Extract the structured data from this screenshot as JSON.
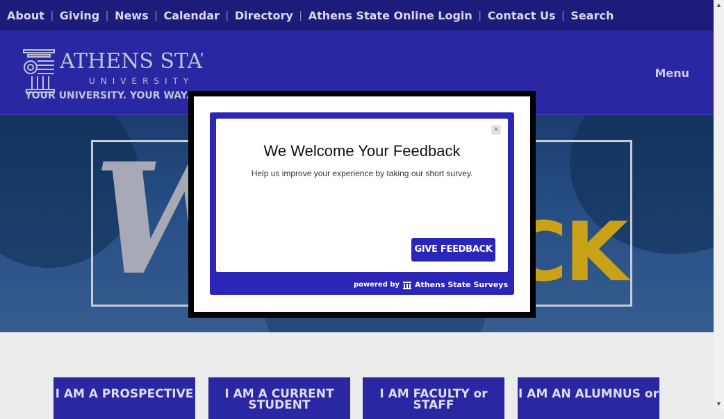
{
  "topnav": {
    "items": [
      "About",
      "Giving",
      "News",
      "Calendar",
      "Directory",
      "Athens State Online Login",
      "Contact Us",
      "Search"
    ],
    "separator": "|"
  },
  "header": {
    "logo": {
      "name": "ATHENS STATE",
      "subtitle": "UNIVERSITY",
      "tagline": "YOUR UNIVERSITY. YOUR WAY."
    },
    "menu_label": "Menu"
  },
  "hero": {
    "letter_left": "W",
    "letters_right": "CK"
  },
  "roles": [
    {
      "label": "I AM A PROSPECTIVE"
    },
    {
      "label": "I AM A CURRENT STUDENT"
    },
    {
      "label": "I AM FACULTY or STAFF"
    },
    {
      "label": "I AM AN ALUMNUS or"
    }
  ],
  "survey": {
    "title": "We Welcome Your Feedback",
    "subtitle": "Help us improve your experience by taking our short survey.",
    "button": "GIVE FEEDBACK",
    "close": "×",
    "powered_by": "powered by",
    "brand": "Athens State Surveys"
  },
  "colors": {
    "topbar": "#1e1c7a",
    "header": "#2a27a3",
    "gold": "#c9a217",
    "survey": "#2c26b8"
  }
}
